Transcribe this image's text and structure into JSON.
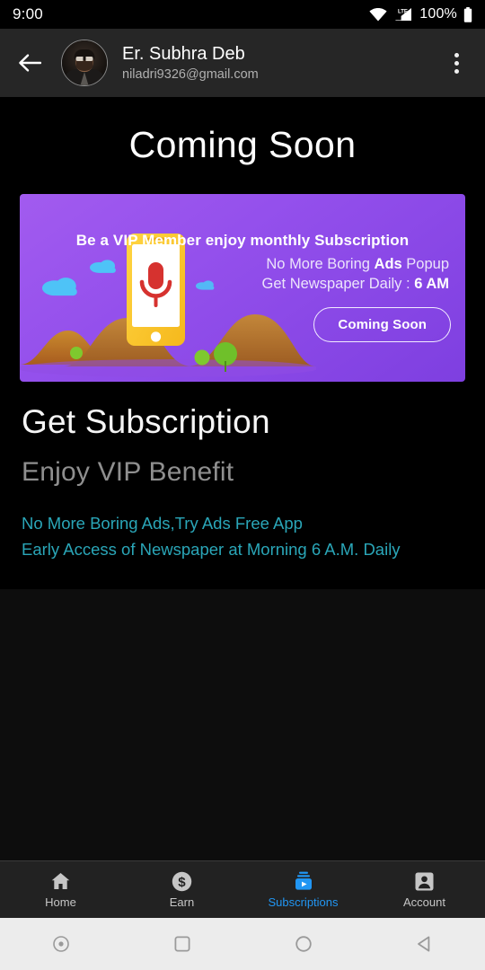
{
  "statusbar": {
    "time": "9:00",
    "battery_text": "100%",
    "icons": [
      "wifi-icon",
      "lte-signal-icon",
      "battery-icon"
    ]
  },
  "appbar": {
    "back_icon": "back-arrow-icon",
    "avatar_alt": "user-profile-photo",
    "user_name": "Er. Subhra Deb",
    "user_email": "niladri9326@gmail.com",
    "overflow_icon": "more-vertical-icon"
  },
  "page": {
    "coming_soon_title": "Coming Soon",
    "section_title": "Get Subscription",
    "section_subtitle": "Enjoy VIP Benefit",
    "benefits": [
      "No More Boring Ads,Try Ads Free App",
      "Early Access of Newspaper at Morning 6 A.M. Daily"
    ],
    "benefit_color": "#2aa6b8"
  },
  "promo": {
    "headline": "Be a VIP Member enjoy monthly Subscription",
    "line1_pre": "No More Boring ",
    "line1_bold": "Ads",
    "line1_post": " Popup",
    "line2_pre": "Get Newspaper Daily : ",
    "line2_bold": "6 AM",
    "cta_label": "Coming Soon",
    "background_color": "#9450ec",
    "illustration": "phone-microphone-landscape-illustration"
  },
  "bottomnav": {
    "active": "Subscriptions",
    "active_color": "#2196f3",
    "items": [
      {
        "label": "Home",
        "icon": "home-icon"
      },
      {
        "label": "Earn",
        "icon": "dollar-coin-icon"
      },
      {
        "label": "Subscriptions",
        "icon": "subscriptions-icon"
      },
      {
        "label": "Account",
        "icon": "account-box-icon"
      }
    ]
  },
  "sysnav": {
    "buttons": [
      {
        "icon": "screenshot-dot-icon"
      },
      {
        "icon": "recents-square-icon"
      },
      {
        "icon": "home-circle-icon"
      },
      {
        "icon": "back-triangle-icon"
      }
    ]
  }
}
